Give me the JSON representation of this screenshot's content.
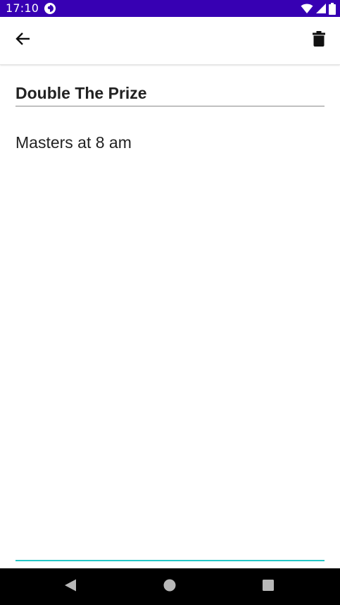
{
  "status_bar": {
    "time": "17:10",
    "background": "#3700b3",
    "icons": [
      "app-notification-icon",
      "wifi-icon",
      "cell-signal-icon",
      "battery-icon"
    ]
  },
  "app_bar": {
    "back_icon": "arrow-back-icon",
    "delete_icon": "trash-icon"
  },
  "note": {
    "title": "Double The Prize",
    "body": "Masters at 8 am",
    "focus_accent": "#26c6c6"
  },
  "nav_bar": {
    "icons": [
      "nav-back-icon",
      "nav-home-icon",
      "nav-recents-icon"
    ]
  }
}
